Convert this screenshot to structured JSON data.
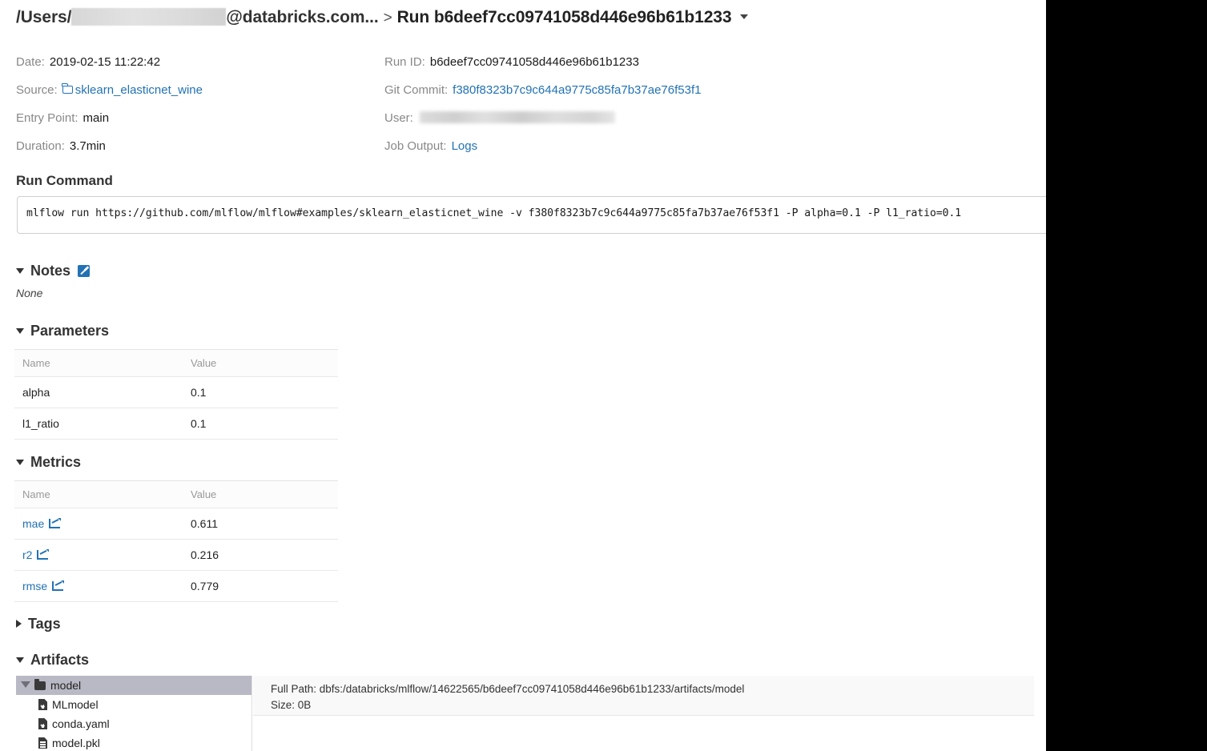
{
  "breadcrumb": {
    "users_prefix": "/Users/",
    "user_redacted": true,
    "domain_suffix": "@databricks.com...",
    "separator": ">",
    "run_title": "Run b6deef7cc09741058d446e96b61b1233",
    "dropdown_icon": "chevron-down-icon"
  },
  "metadata": {
    "left": [
      {
        "label": "Date:",
        "value": "2019-02-15 11:22:42",
        "type": "text"
      },
      {
        "label": "Source:",
        "value": "sklearn_elasticnet_wine",
        "type": "link-folder"
      },
      {
        "label": "Entry Point:",
        "value": "main",
        "type": "text"
      },
      {
        "label": "Duration:",
        "value": "3.7min",
        "type": "text"
      }
    ],
    "right": [
      {
        "label": "Run ID:",
        "value": "b6deef7cc09741058d446e96b61b1233",
        "type": "text"
      },
      {
        "label": "Git Commit:",
        "value": "f380f8323b7c9c644a9775c85fa7b37ae76f53f1",
        "type": "link"
      },
      {
        "label": "User:",
        "value": "",
        "type": "redacted"
      },
      {
        "label": "Job Output:",
        "value": "Logs",
        "type": "link"
      }
    ]
  },
  "run_command": {
    "title": "Run Command",
    "command": "mlflow run https://github.com/mlflow/mlflow#examples/sklearn_elasticnet_wine -v f380f8323b7c9c644a9775c85fa7b37ae76f53f1 -P alpha=0.1 -P l1_ratio=0.1"
  },
  "notes": {
    "title": "Notes",
    "expanded": true,
    "edit_icon": "edit-pencil-icon",
    "body": "None"
  },
  "parameters": {
    "title": "Parameters",
    "expanded": true,
    "columns": [
      "Name",
      "Value"
    ],
    "rows": [
      {
        "name": "alpha",
        "value": "0.1"
      },
      {
        "name": "l1_ratio",
        "value": "0.1"
      }
    ]
  },
  "metrics": {
    "title": "Metrics",
    "expanded": true,
    "columns": [
      "Name",
      "Value"
    ],
    "rows": [
      {
        "name": "mae",
        "value": "0.611",
        "icon": "chart-line-icon"
      },
      {
        "name": "r2",
        "value": "0.216",
        "icon": "chart-line-icon"
      },
      {
        "name": "rmse",
        "value": "0.779",
        "icon": "chart-line-icon"
      }
    ]
  },
  "tags": {
    "title": "Tags",
    "expanded": false
  },
  "artifacts": {
    "title": "Artifacts",
    "expanded": true,
    "tree": [
      {
        "name": "model",
        "kind": "folder",
        "depth": 0,
        "selected": true,
        "expanded": true
      },
      {
        "name": "MLmodel",
        "kind": "code-file",
        "depth": 1,
        "selected": false
      },
      {
        "name": "conda.yaml",
        "kind": "code-file",
        "depth": 1,
        "selected": false
      },
      {
        "name": "model.pkl",
        "kind": "file",
        "depth": 1,
        "selected": false
      }
    ],
    "info": {
      "full_path_label": "Full Path: dbfs:/databricks/mlflow/14622565/b6deef7cc09741058d446e96b61b1233/artifacts/model",
      "size_label": "Size: 0B"
    }
  },
  "colors": {
    "link": "#2272b4",
    "text": "#1a1a1a",
    "muted": "#888888",
    "selection": "#b9b9c5",
    "panel_bg": "#f9f9f9"
  }
}
